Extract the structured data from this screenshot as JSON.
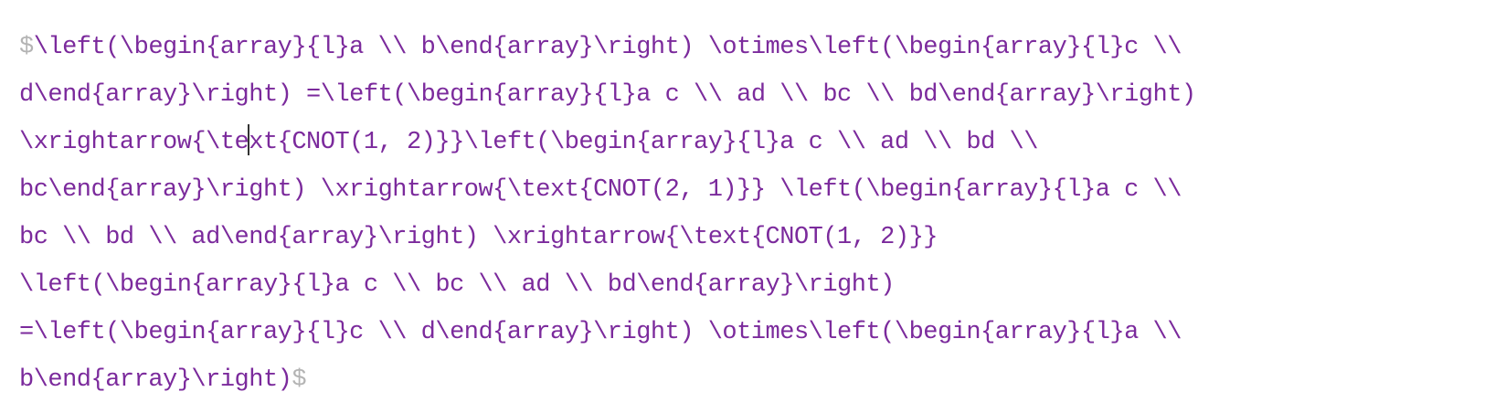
{
  "editor": {
    "open_delimiter": "$",
    "close_delimiter": "$",
    "lines": [
      "\\left(\\begin{array}{l}a \\\\ b\\end{array}\\right) \\otimes\\left(\\begin{array}{l}c \\\\",
      "d\\end{array}\\right) =\\left(\\begin{array}{l}a c \\\\ ad \\\\ bc \\\\ bd\\end{array}\\right)",
      "\\xrightarrow{\\text{CNOT(1, 2)}}\\left(\\begin{array}{l}a c \\\\ ad \\\\ bd \\\\",
      "bc\\end{array}\\right) \\xrightarrow{\\text{CNOT(2, 1)}} \\left(\\begin{array}{l}a c \\\\",
      "bc \\\\ bd \\\\ ad\\end{array}\\right) \\xrightarrow{\\text{CNOT(1, 2)}}",
      "\\left(\\begin{array}{l}a c \\\\ bc \\\\ ad \\\\ bd\\end{array}\\right)",
      "=\\left(\\begin{array}{l}c \\\\ d\\end{array}\\right) \\otimes\\left(\\begin{array}{l}a \\\\",
      "b\\end{array}\\right)"
    ],
    "caret_line_prefix": "\\xrightarrow{\\te",
    "caret_line_suffix": "xt{CNOT(1, 2)}}\\left(\\begin{array}{l}a c \\\\ ad \\\\ bd \\\\"
  }
}
